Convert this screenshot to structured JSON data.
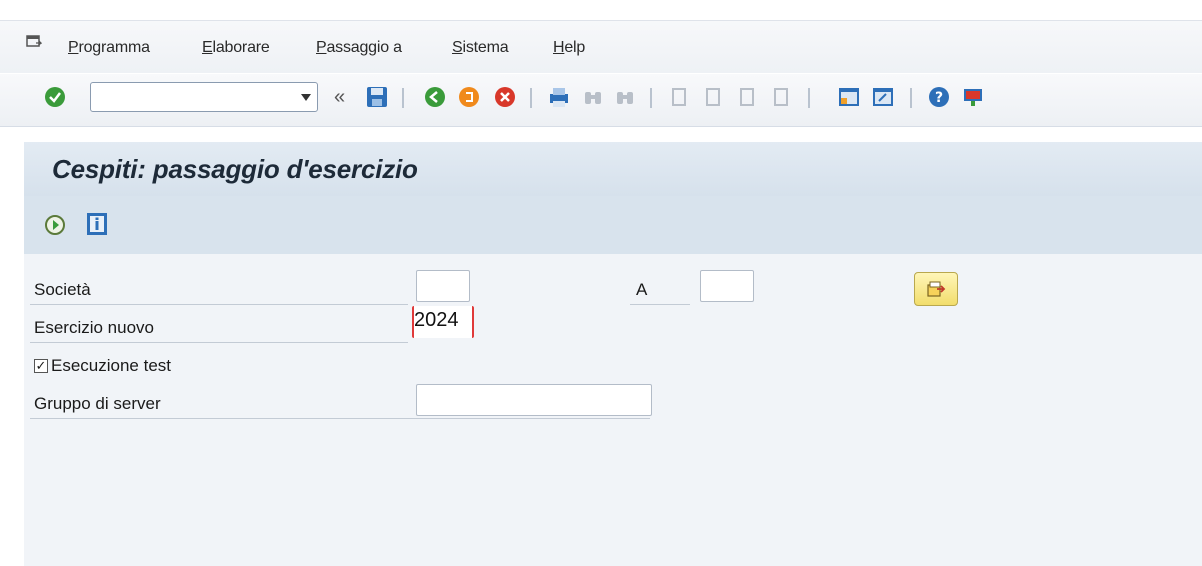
{
  "menu": {
    "items": [
      {
        "label": "Programma"
      },
      {
        "label": "Elaborare"
      },
      {
        "label": "Passaggio a"
      },
      {
        "label": "Sistema"
      },
      {
        "label": "Help"
      }
    ]
  },
  "toolbar": {
    "command_field_value": "",
    "back_glyph": "«"
  },
  "screen": {
    "title": "Cespiti: passaggio d'esercizio"
  },
  "form": {
    "societa_label": "Società",
    "societa_from_value": "",
    "to_label": "A",
    "societa_to_value": "",
    "esercizio_label": "Esercizio nuovo",
    "esercizio_value": "2024",
    "test_label": "Esecuzione test",
    "test_checked": "✓",
    "gruppo_label": "Gruppo di server",
    "gruppo_value": ""
  },
  "colors": {
    "accent_green": "#3a9b3a",
    "accent_orange": "#f08a1c",
    "accent_red": "#d8382a",
    "accent_blue": "#2d6fb8",
    "header_bg": "#d6e1ec"
  }
}
